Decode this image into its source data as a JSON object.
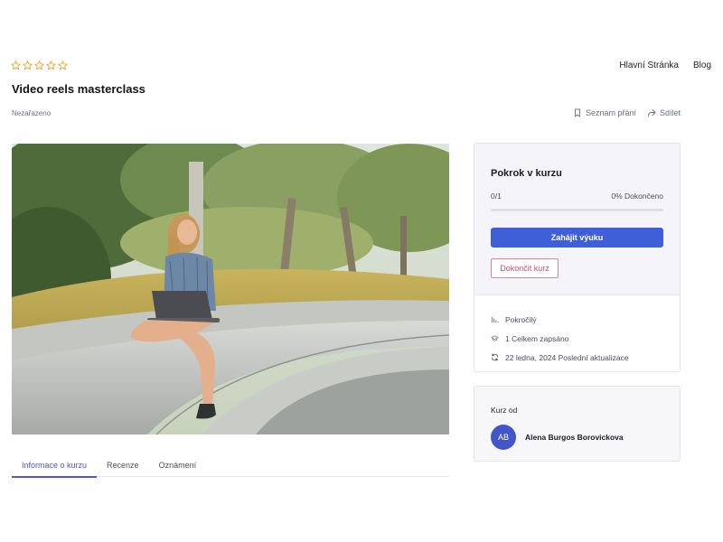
{
  "nav": {
    "items": [
      {
        "label": "Hlavní Stránka"
      },
      {
        "label": "Blog"
      }
    ]
  },
  "course": {
    "rating_stars": 0,
    "rating_max": 5,
    "title": "Video reels masterclass",
    "category": "Nezařazeno"
  },
  "actions": {
    "wishlist_label": "Seznam přání",
    "share_label": "Sdílet"
  },
  "tabs": [
    {
      "label": "Informace o kurzu",
      "active": true
    },
    {
      "label": "Recenze",
      "active": false
    },
    {
      "label": "Oznámení",
      "active": false
    }
  ],
  "progress": {
    "title": "Pokrok v kurzu",
    "count": "0/1",
    "percent_text": "0% Dokončeno",
    "fraction": 0,
    "start_button": "Zahájit výuku",
    "finish_button": "Dokončit kurz"
  },
  "info": {
    "level": "Pokročilý",
    "enrolled": "1 Celkem zapsáno",
    "updated": "22 ledna, 2024 Poslední aktualizace"
  },
  "author": {
    "label": "Kurz od",
    "initials": "AB",
    "name": "Alena Burgos Borovickova"
  },
  "icons": {
    "star": "star-outline-icon",
    "wishlist": "bookmark-icon",
    "share": "share-icon",
    "level": "bar-chart-icon",
    "enrolled": "graduation-cap-icon",
    "updated": "refresh-icon"
  },
  "colors": {
    "accent": "#4a55d8",
    "primary_button": "#3f5fd9",
    "finish_button": "#c2497f",
    "star": "#e0a123",
    "avatar": "#4256c7"
  }
}
